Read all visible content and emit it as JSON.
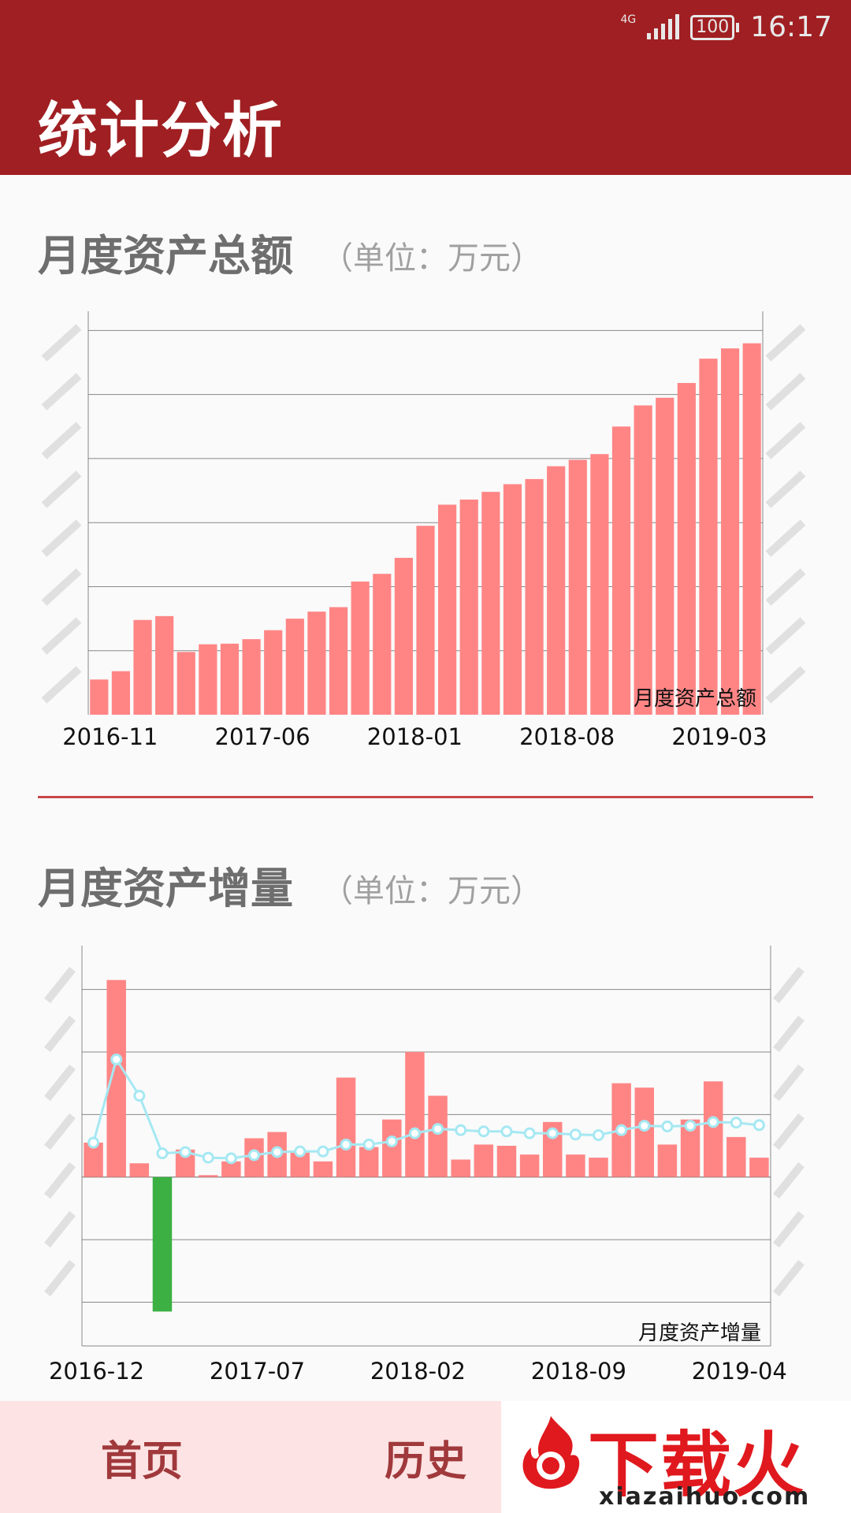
{
  "status_bar": {
    "network": "4G",
    "battery": "100",
    "time": "16:17"
  },
  "header": {
    "title": "统计分析"
  },
  "sections": [
    {
      "title": "月度资产总额",
      "unit": "（单位：万元）"
    },
    {
      "title": "月度资产增量",
      "unit": "（单位：万元）"
    }
  ],
  "chart_data": [
    {
      "type": "bar",
      "title": "",
      "legend": "月度资产总额",
      "legend_position": "bottom-right",
      "grid": true,
      "ylim": [
        0,
        6.3
      ],
      "x_tick_labels": [
        "2016-11",
        "2017-06",
        "2018-01",
        "2018-08",
        "2019-03"
      ],
      "series": [
        {
          "name": "月度资产总额",
          "color": "#ff8585",
          "values": [
            0.55,
            0.68,
            1.48,
            1.54,
            0.98,
            1.1,
            1.11,
            1.18,
            1.32,
            1.5,
            1.61,
            1.68,
            2.08,
            2.2,
            2.45,
            2.95,
            3.28,
            3.36,
            3.48,
            3.6,
            3.68,
            3.88,
            3.98,
            4.07,
            4.5,
            4.83,
            4.95,
            5.18,
            5.56,
            5.72,
            5.8
          ]
        }
      ]
    },
    {
      "type": "bar",
      "title": "",
      "legend": "月度资产增量",
      "legend_position": "bottom-right",
      "grid": true,
      "ylim": [
        -2.7,
        3.7
      ],
      "x_tick_labels": [
        "2016-12",
        "2017-07",
        "2018-02",
        "2018-09",
        "2019-04"
      ],
      "series": [
        {
          "name": "月度资产增量",
          "color_positive": "#ff8585",
          "color_negative": "#3cb043",
          "values": [
            0.55,
            3.15,
            0.22,
            -2.15,
            0.44,
            0.03,
            0.25,
            0.62,
            0.72,
            0.39,
            0.25,
            1.59,
            0.48,
            0.92,
            2.0,
            1.3,
            0.28,
            0.52,
            0.5,
            0.36,
            0.88,
            0.36,
            0.31,
            1.5,
            1.43,
            0.52,
            0.92,
            1.53,
            0.64,
            0.31
          ]
        },
        {
          "type": "line",
          "color": "#a5e8f2",
          "values": [
            0.55,
            1.88,
            1.3,
            0.38,
            0.4,
            0.31,
            0.3,
            0.35,
            0.4,
            0.41,
            0.41,
            0.52,
            0.52,
            0.57,
            0.7,
            0.77,
            0.75,
            0.73,
            0.73,
            0.7,
            0.7,
            0.68,
            0.67,
            0.75,
            0.82,
            0.81,
            0.82,
            0.88,
            0.87,
            0.83
          ]
        }
      ]
    }
  ],
  "tabbar": {
    "items": [
      "首页",
      "历史"
    ]
  },
  "watermark": {
    "word": "下载火",
    "url": "xiazaihuo.com"
  },
  "colors": {
    "header": "#a01f22",
    "divider": "#c8454a",
    "tabbar": "#fde3e3",
    "tab_text": "#a0393c"
  }
}
